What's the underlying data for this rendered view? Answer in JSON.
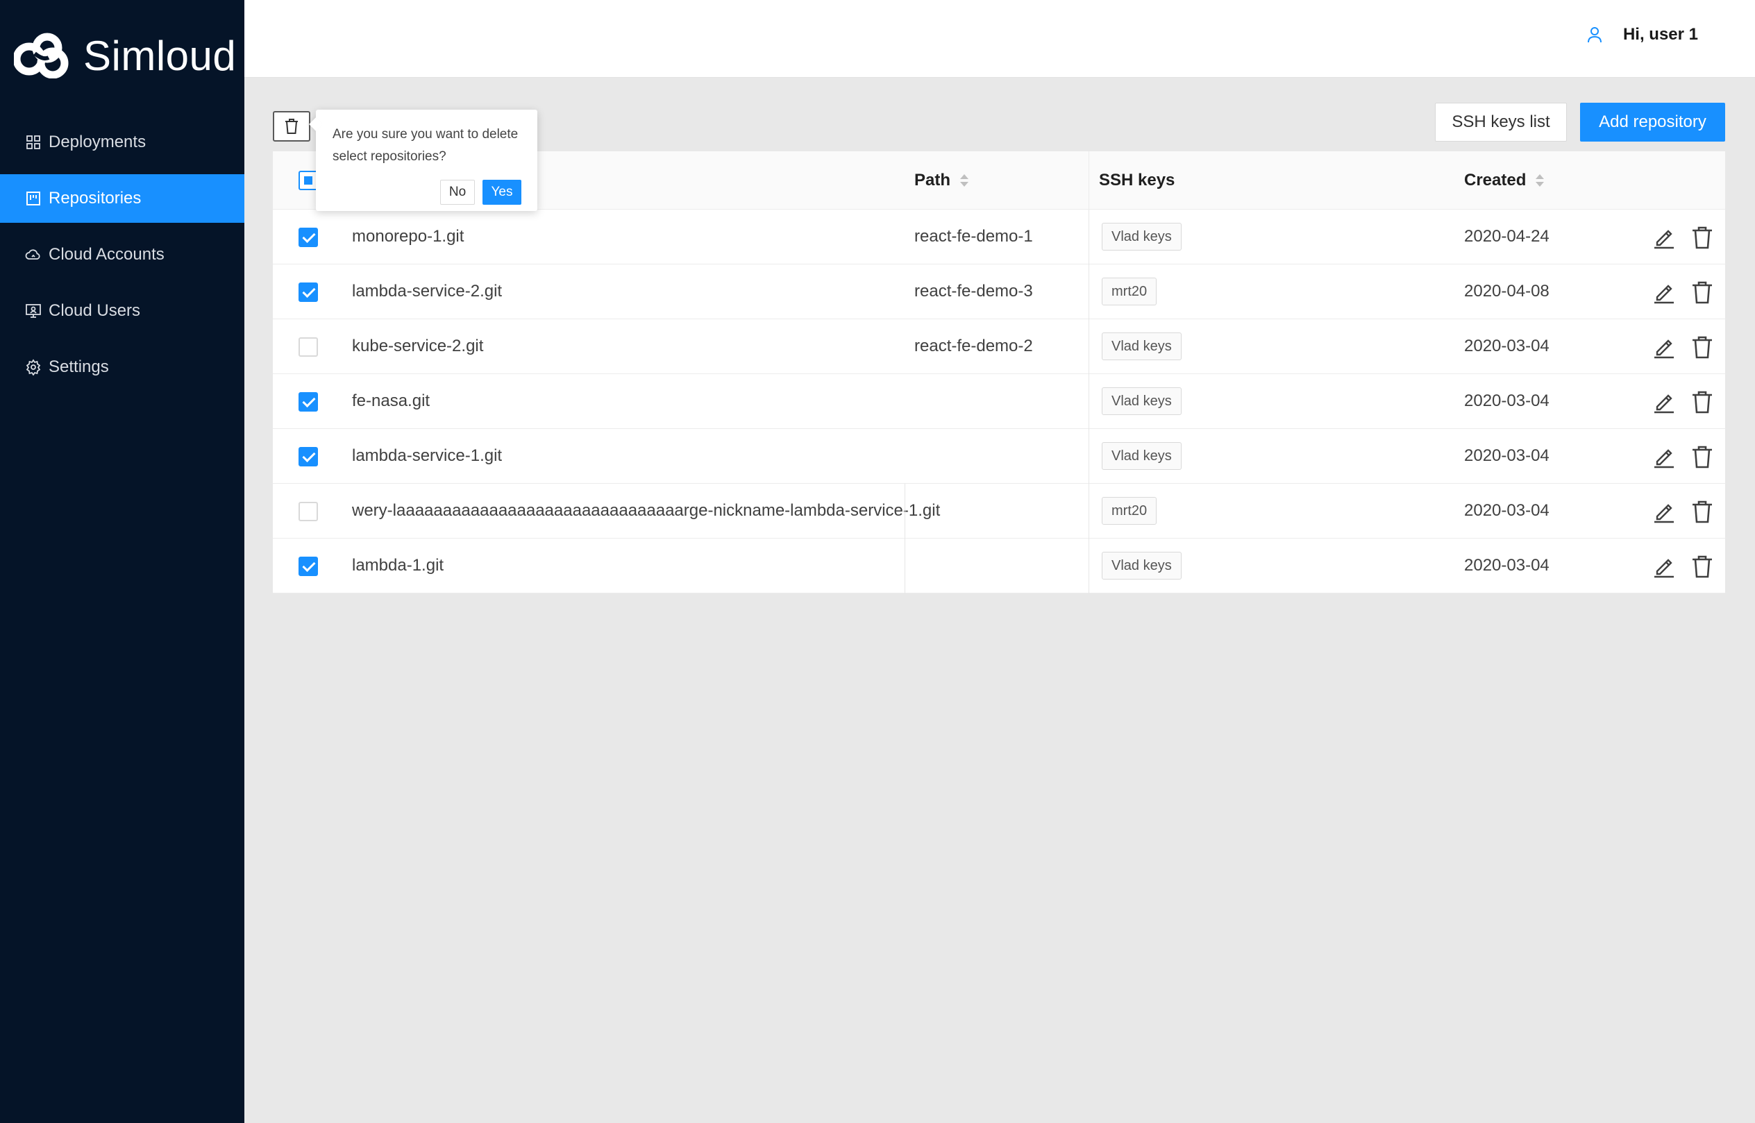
{
  "app": {
    "name": "Simloud"
  },
  "sidebar": {
    "items": [
      {
        "label": "Deployments",
        "icon": "grid-icon",
        "active": false
      },
      {
        "label": "Repositories",
        "icon": "repository-icon",
        "active": true
      },
      {
        "label": "Cloud Accounts",
        "icon": "cloud-icon",
        "active": false
      },
      {
        "label": "Cloud Users",
        "icon": "monitor-user-icon",
        "active": false
      },
      {
        "label": "Settings",
        "icon": "gear-icon",
        "active": false
      }
    ]
  },
  "header": {
    "greeting": "Hi, user 1",
    "user_icon": "user-icon"
  },
  "toolbar": {
    "ssh_keys_label": "SSH keys list",
    "add_repository_label": "Add repository"
  },
  "popconfirm": {
    "message": "Are you sure you want to delete select repositories?",
    "no_label": "No",
    "yes_label": "Yes"
  },
  "table": {
    "columns": {
      "path": "Path",
      "ssh_keys": "SSH keys",
      "created": "Created"
    },
    "rows": [
      {
        "checked": true,
        "name": "monorepo-1.git",
        "path": "react-fe-demo-1",
        "ssh_key": "Vlad keys",
        "created": "2020-04-24"
      },
      {
        "checked": true,
        "name": "lambda-service-2.git",
        "path": "react-fe-demo-3",
        "ssh_key": "mrt20",
        "created": "2020-04-08"
      },
      {
        "checked": false,
        "name": "kube-service-2.git",
        "path": "react-fe-demo-2",
        "ssh_key": "Vlad keys",
        "created": "2020-03-04"
      },
      {
        "checked": true,
        "name": "fe-nasa.git",
        "path": "",
        "ssh_key": "Vlad keys",
        "created": "2020-03-04"
      },
      {
        "checked": true,
        "name": "lambda-service-1.git",
        "path": "",
        "ssh_key": "Vlad keys",
        "created": "2020-03-04"
      },
      {
        "checked": false,
        "name": "wery-laaaaaaaaaaaaaaaaaaaaaaaaaaaaaaarge-nickname-lambda-service-1.git",
        "path": "",
        "ssh_key": "mrt20",
        "created": "2020-03-04"
      },
      {
        "checked": true,
        "name": "lambda-1.git",
        "path": "",
        "ssh_key": "Vlad keys",
        "created": "2020-03-04"
      }
    ]
  },
  "colors": {
    "accent": "#1890ff",
    "sidebar_bg": "#051428",
    "page_bg": "#e8e8e8"
  }
}
